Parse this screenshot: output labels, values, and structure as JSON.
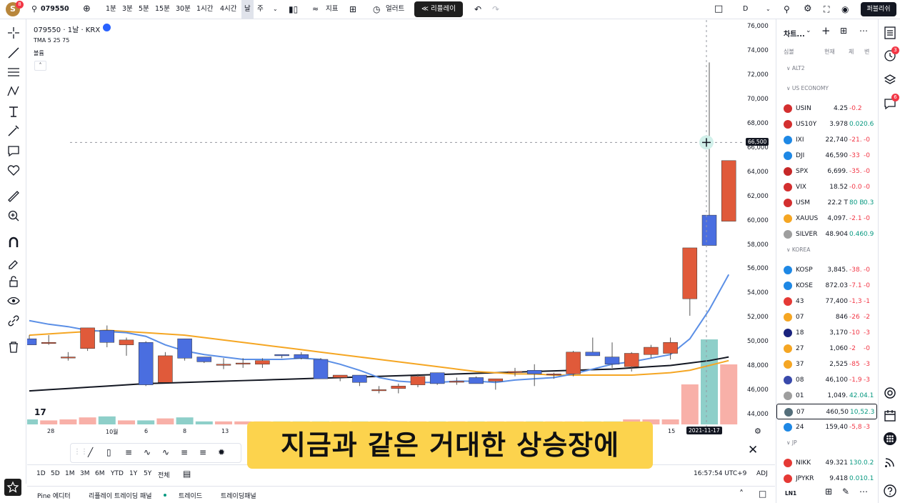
{
  "toolbar": {
    "symbol": "079550",
    "intervals": [
      "1분",
      "3분",
      "5분",
      "15분",
      "30분",
      "1시간",
      "4시간",
      "날",
      "주"
    ],
    "indicators_label": "지표",
    "alert_label": "얼러트",
    "replay_label": "리플레이",
    "layout_letter": "D",
    "publish_label": "퍼블리쉬",
    "avatar_badge": "8"
  },
  "chart": {
    "title": "079550 · 1날 · KRX",
    "indicator_legend": "TMA 5 25 75",
    "volume_legend": "볼륨",
    "price_ticks": [
      "76,000",
      "74,000",
      "72,000",
      "70,000",
      "68,000",
      "66,000",
      "64,000",
      "62,000",
      "60,000",
      "58,000",
      "56,000",
      "54,000",
      "52,000",
      "50,000",
      "48,000",
      "46,000",
      "44,000"
    ],
    "crosshair_price": "66,500",
    "crosshair_date": "2021-11-17",
    "date_ticks": [
      "28",
      "10월",
      "6",
      "8",
      "13",
      "15"
    ]
  },
  "chart_data": {
    "type": "candlestick",
    "yrange": [
      43000,
      76500
    ],
    "candles": [
      {
        "o": 50300,
        "h": 50600,
        "l": 49800,
        "c": 49800
      },
      {
        "o": 50000,
        "h": 50600,
        "l": 49800,
        "c": 50000
      },
      {
        "o": 48800,
        "h": 49200,
        "l": 48500,
        "c": 48800
      },
      {
        "o": 49500,
        "h": 51200,
        "l": 49300,
        "c": 51200
      },
      {
        "o": 51000,
        "h": 51400,
        "l": 49600,
        "c": 50000
      },
      {
        "o": 49800,
        "h": 50400,
        "l": 48900,
        "c": 50200
      },
      {
        "o": 50000,
        "h": 50100,
        "l": 46400,
        "c": 46500
      },
      {
        "o": 46700,
        "h": 49200,
        "l": 46700,
        "c": 48900
      },
      {
        "o": 50300,
        "h": 50300,
        "l": 48500,
        "c": 48700
      },
      {
        "o": 48800,
        "h": 48800,
        "l": 48300,
        "c": 48400
      },
      {
        "o": 48200,
        "h": 48700,
        "l": 47800,
        "c": 48200
      },
      {
        "o": 48300,
        "h": 48700,
        "l": 47900,
        "c": 48300
      },
      {
        "o": 48200,
        "h": 48700,
        "l": 47900,
        "c": 48500
      },
      {
        "o": 49000,
        "h": 49000,
        "l": 48700,
        "c": 48900
      },
      {
        "o": 49000,
        "h": 49200,
        "l": 48600,
        "c": 48700
      },
      {
        "o": 48600,
        "h": 48700,
        "l": 47000,
        "c": 47000
      },
      {
        "o": 47100,
        "h": 47200,
        "l": 46800,
        "c": 47300
      },
      {
        "o": 47300,
        "h": 47300,
        "l": 46400,
        "c": 46700
      },
      {
        "o": 46100,
        "h": 46400,
        "l": 45800,
        "c": 46100
      },
      {
        "o": 46200,
        "h": 46600,
        "l": 45800,
        "c": 46400
      },
      {
        "o": 46500,
        "h": 47400,
        "l": 46300,
        "c": 47200
      },
      {
        "o": 47500,
        "h": 47500,
        "l": 46500,
        "c": 46600
      },
      {
        "o": 46800,
        "h": 47100,
        "l": 46500,
        "c": 46800
      },
      {
        "o": 47100,
        "h": 47200,
        "l": 46600,
        "c": 46600
      },
      {
        "o": 46800,
        "h": 47000,
        "l": 46100,
        "c": 47000
      },
      {
        "o": 47600,
        "h": 47900,
        "l": 47200,
        "c": 47600
      },
      {
        "o": 47700,
        "h": 48200,
        "l": 46400,
        "c": 47400
      },
      {
        "o": 47400,
        "h": 47500,
        "l": 47000,
        "c": 47400
      },
      {
        "o": 47400,
        "h": 49300,
        "l": 47200,
        "c": 49200
      },
      {
        "o": 49200,
        "h": 50400,
        "l": 49000,
        "c": 48900
      },
      {
        "o": 48800,
        "h": 50000,
        "l": 47900,
        "c": 48200
      },
      {
        "o": 48000,
        "h": 49200,
        "l": 47600,
        "c": 49100
      },
      {
        "o": 49000,
        "h": 49800,
        "l": 48700,
        "c": 49600
      },
      {
        "o": 49100,
        "h": 50400,
        "l": 48600,
        "c": 50000
      },
      {
        "o": 53600,
        "h": 57800,
        "l": 52200,
        "c": 57800
      },
      {
        "o": 60500,
        "h": 73100,
        "l": 58100,
        "c": 58000
      },
      {
        "o": 60000,
        "h": 65000,
        "l": 60000,
        "c": 65000
      }
    ],
    "ma_fast": [
      51800,
      51500,
      51300,
      51000,
      50900,
      50800,
      50500,
      49800,
      49300,
      49000,
      48800,
      48600,
      48600,
      48600,
      48700,
      48600,
      48200,
      47700,
      47100,
      46800,
      46700,
      46700,
      46800,
      46800,
      46700,
      46900,
      47000,
      47100,
      47400,
      47800,
      48200,
      48400,
      48700,
      49000,
      50300,
      52700,
      55600
    ],
    "ma_mid": [
      50600,
      50700,
      50800,
      50900,
      51000,
      50900,
      50800,
      50700,
      50600,
      50400,
      50200,
      50000,
      49800,
      49600,
      49400,
      49200,
      49000,
      48800,
      48600,
      48400,
      48200,
      48000,
      47800,
      47600,
      47500,
      47400,
      47400,
      47300,
      47300,
      47300,
      47300,
      47300,
      47400,
      47500,
      47700,
      48100,
      48500
    ],
    "ma_slow": [
      46000,
      46100,
      46200,
      46300,
      46400,
      46500,
      46600,
      46650,
      46700,
      46750,
      46800,
      46850,
      46900,
      46950,
      47000,
      47050,
      47100,
      47150,
      47200,
      47250,
      47300,
      47350,
      47400,
      47450,
      47500,
      47550,
      47600,
      47650,
      47700,
      47750,
      47800,
      47900,
      48000,
      48100,
      48300,
      48500,
      48800
    ],
    "volume": [
      0.5,
      0.4,
      0.5,
      0.7,
      0.8,
      0.4,
      0.4,
      0.6,
      0.7,
      0.3,
      0.3,
      0.3,
      0.3,
      0.3,
      0.3,
      0.3,
      0.3,
      0.3,
      0.3,
      0.3,
      0.3,
      0.3,
      0.3,
      0.3,
      0.3,
      0.3,
      0.3,
      0.3,
      0.3,
      0.3,
      0.3,
      0.5,
      0.5,
      0.5,
      4.0,
      8.5,
      6.0
    ],
    "colors": {
      "up": "#e05a3a",
      "down": "#4a6ee0",
      "up_vol": "#f8b0a8",
      "down_vol": "#8ecfc9",
      "ma_fast": "#5b8fe6",
      "ma_mid": "#f5a623",
      "ma_slow": "#131722"
    }
  },
  "watchlist": {
    "title": "차트...",
    "cols": [
      "심볼",
      "현재",
      "체",
      "변"
    ],
    "sections": [
      {
        "name": "ALT2",
        "rows": []
      },
      {
        "name": "US ECONOMY",
        "rows": [
          {
            "sym": "USIN",
            "last": "4.25",
            "chg": "-0.2",
            "pct": "",
            "color": "#d32f2f",
            "dir": "neg"
          },
          {
            "sym": "US10Y",
            "last": "3.978",
            "chg": "0.02",
            "pct": "0.6",
            "color": "#d32f2f",
            "dir": "pos"
          },
          {
            "sym": "IXI",
            "last": "22,740",
            "chg": "-21.",
            "pct": "-0",
            "color": "#1e88e5",
            "dir": "neg"
          },
          {
            "sym": "DJI",
            "last": "46,590",
            "chg": "-33",
            "pct": "-0",
            "color": "#1e88e5",
            "dir": "neg"
          },
          {
            "sym": "SPX",
            "last": "6,699.",
            "chg": "-35.",
            "pct": "-0",
            "color": "#c62828",
            "dir": "neg"
          },
          {
            "sym": "VIX",
            "last": "18.52",
            "chg": "-0.0",
            "pct": "-0",
            "color": "#d32f2f",
            "dir": "neg"
          },
          {
            "sym": "USM",
            "last": "22.2 T",
            "chg": "80 B",
            "pct": "0.3",
            "color": "#d32f2f",
            "dir": "pos"
          },
          {
            "sym": "XAUUS",
            "last": "4,097.",
            "chg": "-2.1",
            "pct": "-0",
            "color": "#f5a623",
            "dir": "neg"
          },
          {
            "sym": "SILVER",
            "last": "48.904",
            "chg": "0.46",
            "pct": "0.9",
            "color": "#9e9e9e",
            "dir": "pos"
          }
        ]
      },
      {
        "name": "KOREA",
        "rows": [
          {
            "sym": "KOSP",
            "last": "3,845.",
            "chg": "-38.",
            "pct": "-0",
            "color": "#1e88e5",
            "dir": "neg"
          },
          {
            "sym": "KOSE",
            "last": "872.03",
            "chg": "-7.1",
            "pct": "-0",
            "color": "#1e88e5",
            "dir": "neg"
          },
          {
            "sym": "43",
            "last": "77,400",
            "chg": "-1,3",
            "pct": "-1",
            "color": "#e53935",
            "dir": "neg"
          },
          {
            "sym": "07",
            "last": "846",
            "chg": "-26",
            "pct": "-2",
            "color": "#f5a623",
            "dir": "neg"
          },
          {
            "sym": "18",
            "last": "3,170",
            "chg": "-10",
            "pct": "-3",
            "color": "#1a237e",
            "dir": "neg"
          },
          {
            "sym": "27",
            "last": "1,060",
            "chg": "-2",
            "pct": "-0",
            "color": "#f5a623",
            "dir": "neg"
          },
          {
            "sym": "37",
            "last": "2,525",
            "chg": "-85",
            "pct": "-3",
            "color": "#f5a623",
            "dir": "neg"
          },
          {
            "sym": "08",
            "last": "46,100",
            "chg": "-1,9",
            "pct": "-3",
            "color": "#3949ab",
            "dir": "neg"
          },
          {
            "sym": "01",
            "last": "1,049.",
            "chg": "42.0",
            "pct": "4.1",
            "color": "#9e9e9e",
            "dir": "pos"
          },
          {
            "sym": "07",
            "last": "460,50",
            "chg": "10,5",
            "pct": "2.3",
            "color": "#546e7a",
            "dir": "pos"
          },
          {
            "sym": "24",
            "last": "159,40",
            "chg": "-5,8",
            "pct": "-3",
            "color": "#1e88e5",
            "dir": "neg"
          }
        ]
      },
      {
        "name": "JP",
        "rows": [
          {
            "sym": "NIKK",
            "last": "49.321",
            "chg": "130.",
            "pct": "0.2",
            "color": "#e53935",
            "dir": "pos"
          },
          {
            "sym": "JPYKR",
            "last": "9.418",
            "chg": "0.01",
            "pct": "0.1",
            "color": "#e53935",
            "dir": "pos"
          }
        ]
      }
    ],
    "footer_label": "LN1"
  },
  "bottom": {
    "ranges": [
      "1D",
      "5D",
      "1M",
      "3M",
      "6M",
      "YTD",
      "1Y",
      "5Y",
      "전체"
    ],
    "time": "16:57:54 UTC+9",
    "adj": "ADJ"
  },
  "footer": {
    "tabs": [
      "Pine 에디터",
      "리플레이 트레이딩 패널",
      "트레이드",
      "트레이딩패널"
    ]
  },
  "subtitle": "지금과 같은 거대한 상승장에",
  "badges": {
    "alerts": "3",
    "chat": "6"
  }
}
